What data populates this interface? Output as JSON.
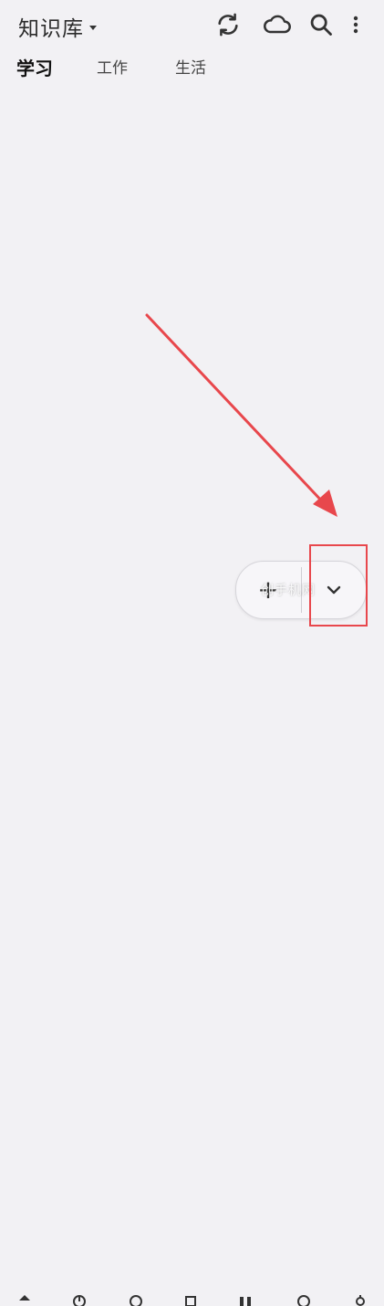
{
  "header": {
    "title": "知识库",
    "icons": [
      "sync-icon",
      "cloud-icon",
      "search-icon",
      "more-vertical-icon"
    ]
  },
  "tabs": [
    {
      "label": "学习",
      "active": true
    },
    {
      "label": "工作",
      "active": false
    },
    {
      "label": "生活",
      "active": false
    }
  ],
  "fab": {
    "add_symbol": "+",
    "more_symbol": "⌄",
    "watermark": "创手机网"
  },
  "colors": {
    "background": "#f2f1f4",
    "annotation": "#e8474c"
  },
  "bottom_nav": {
    "icons": [
      "home-icon",
      "chart-icon",
      "compass-icon",
      "clipboard-icon",
      "grid-icon",
      "search-circle-icon",
      "settings-icon"
    ]
  }
}
